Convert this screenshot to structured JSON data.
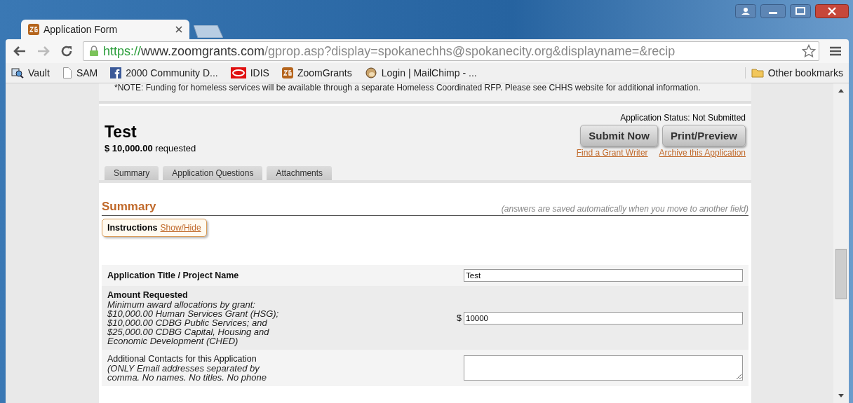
{
  "browser": {
    "tabs": [
      {
        "title": "Application Form",
        "selected": true
      }
    ],
    "address": {
      "secure_part": "https://",
      "host": "www.zoomgrants.com",
      "path": "/gprop.asp?display=spokanechhs@spokanecity.org&displayname=&recip"
    },
    "bookmarks": [
      {
        "label": "Vault",
        "kind": "vault"
      },
      {
        "label": "SAM",
        "kind": "page"
      },
      {
        "label": "2000 Community D...",
        "kind": "facebook"
      },
      {
        "label": "IDIS",
        "kind": "idis"
      },
      {
        "label": "ZoomGrants",
        "kind": "zg"
      },
      {
        "label": "Login | MailChimp - ...",
        "kind": "chimp"
      }
    ],
    "other_bookmarks": "Other bookmarks"
  },
  "note": "*NOTE: Funding for homeless services will be available through a separate Homeless Coordinated RFP. Please see CHHS website for additional information.",
  "application": {
    "title": "Test",
    "amount": "$ 10,000.00",
    "amount_suffix": "requested",
    "status": "Application Status: Not Submitted",
    "buttons": [
      "Submit Now",
      "Print/Preview"
    ],
    "links": [
      "Find a Grant Writer",
      "Archive this Application"
    ],
    "tabs": [
      {
        "label": "Summary",
        "selected": false
      },
      {
        "label": "Application Questions",
        "selected": false
      },
      {
        "label": "Attachments",
        "selected": false
      }
    ]
  },
  "section": {
    "title": "Summary",
    "hint": "(answers are saved automatically when you move to another field)",
    "instructions": "Instructions",
    "toggle": "Show/Hide"
  },
  "fields": [
    {
      "kind": "text",
      "label": "Application Title / Project Name",
      "bold": true,
      "value": "Test"
    },
    {
      "kind": "money",
      "label": "Amount Requested",
      "bold": true,
      "help": "Minimum award allocations by grant: $10,000.00 Human Services Grant (HSG); $10,000.00 CDBG Public Services; and $25,000.00 CDBG Capital, Housing and Economic Development (CHED)",
      "prefix": "$",
      "value": "10000"
    },
    {
      "kind": "textarea",
      "label": "Additional Contacts for this Application",
      "bold": false,
      "help": "(ONLY Email addresses separated by comma. No names. No titles. No phone"
    }
  ]
}
